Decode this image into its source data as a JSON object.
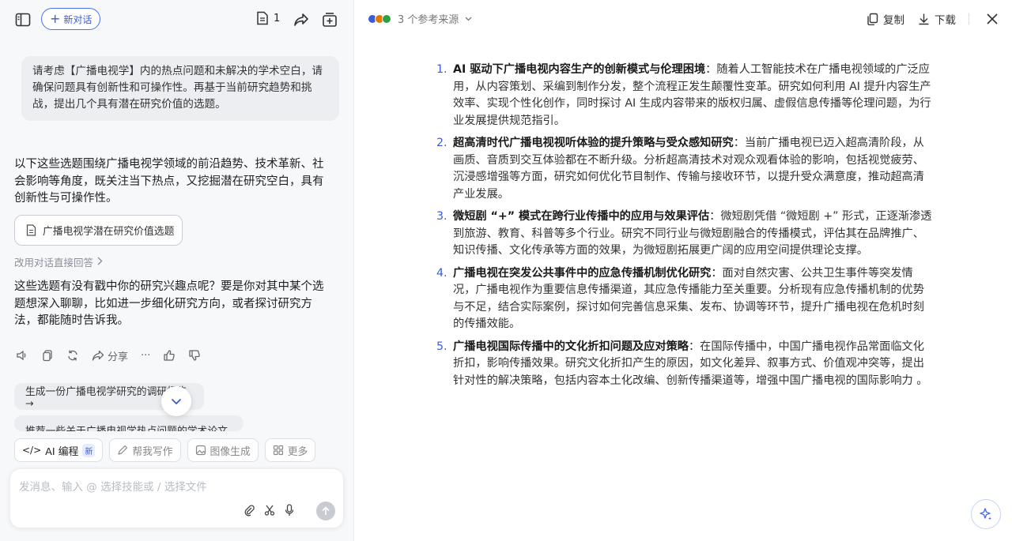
{
  "topbar": {
    "new_chat_label": "新对话",
    "doc_count": "1"
  },
  "chat": {
    "user_message": "请考虑【广播电视学】内的热点问题和未解决的学术空白，请确保问题具有创新性和可操作性。再基于当前研究趋势和挑战，提出几个具有潜在研究价值的选题。",
    "answer_intro": "以下这些选题围绕广播电视学领域的前沿趋势、技术革新、社会影响等角度，既关注当下热点，又挖掘潜在研究空白，具有创新性与可操作性。",
    "doc_card_title": "广播电视学潜在研究价值选题",
    "switch_link": "改用对话直接回答",
    "answer_outro": "这些选题有没有戳中你的研究兴趣点呢？要是你对其中某个选题想深入聊聊，比如进一步细化研究方向，或者探讨研究方法，都能随时告诉我。",
    "share_label": "分享",
    "more_actions": "···"
  },
  "suggestions": [
    "生成一份广播电视学研究的调研报告 →",
    "推荐一些关于广播电视学热点问题的学术论文 →"
  ],
  "skills": {
    "ai_coding": "AI 编程",
    "ai_coding_badge": "新",
    "writing": "帮我写作",
    "image_gen": "图像生成",
    "more": "更多"
  },
  "composer": {
    "placeholder": "发消息、输入 @ 选择技能或 / 选择文件"
  },
  "panel": {
    "sources_label": "3 个参考来源",
    "copy_label": "复制",
    "download_label": "下载",
    "items": [
      {
        "num": "1.",
        "title": "AI 驱动下广播电视内容生产的创新模式与伦理困境",
        "sep": "：",
        "text": "随着人工智能技术在广播电视领域的广泛应用，从内容策划、采编到制作分发，整个流程正发生颠覆性变革。研究如何利用 AI 提升内容生产效率、实现个性化创作，同时探讨 AI 生成内容带来的版权归属、虚假信息传播等伦理问题，为行业发展提供规范指引。"
      },
      {
        "num": "2.",
        "title": "超高清时代广播电视视听体验的提升策略与受众感知研究",
        "sep": "：",
        "text": "当前广播电视已迈入超高清阶段，从画质、音质到交互体验都在不断升级。分析超高清技术对观众观看体验的影响，包括视觉疲劳、沉浸感增强等方面，研究如何优化节目制作、传输与接收环节，以提升受众满意度，推动超高清产业发展。"
      },
      {
        "num": "3.",
        "title": "微短剧 “+” 模式在跨行业传播中的应用与效果评估",
        "sep": "：",
        "text": "微短剧凭借 “微短剧 +” 形式，正逐渐渗透到旅游、教育、科普等多个行业。研究不同行业与微短剧融合的传播模式，评估其在品牌推广、知识传播、文化传承等方面的效果，为微短剧拓展更广阔的应用空间提供理论支撑。"
      },
      {
        "num": "4.",
        "title": "广播电视在突发公共事件中的应急传播机制优化研究",
        "sep": "：",
        "text": "面对自然灾害、公共卫生事件等突发情况，广播电视作为重要信息传播渠道，其应急传播能力至关重要。分析现有应急传播机制的优势与不足，结合实际案例，探讨如何完善信息采集、发布、协调等环节，提升广播电视在危机时刻的传播效能。"
      },
      {
        "num": "5.",
        "title": "广播电视国际传播中的文化折扣问题及应对策略",
        "sep": "：",
        "text": "在国际传播中，中国广播电视作品常面临文化折扣，影响传播效果。研究文化折扣产生的原因，如文化差异、叙事方式、价值观冲突等，提出针对性的解决策略，包括内容本土化改编、创新传播渠道等，增强中国广播电视的国际影响力 。"
      }
    ]
  }
}
